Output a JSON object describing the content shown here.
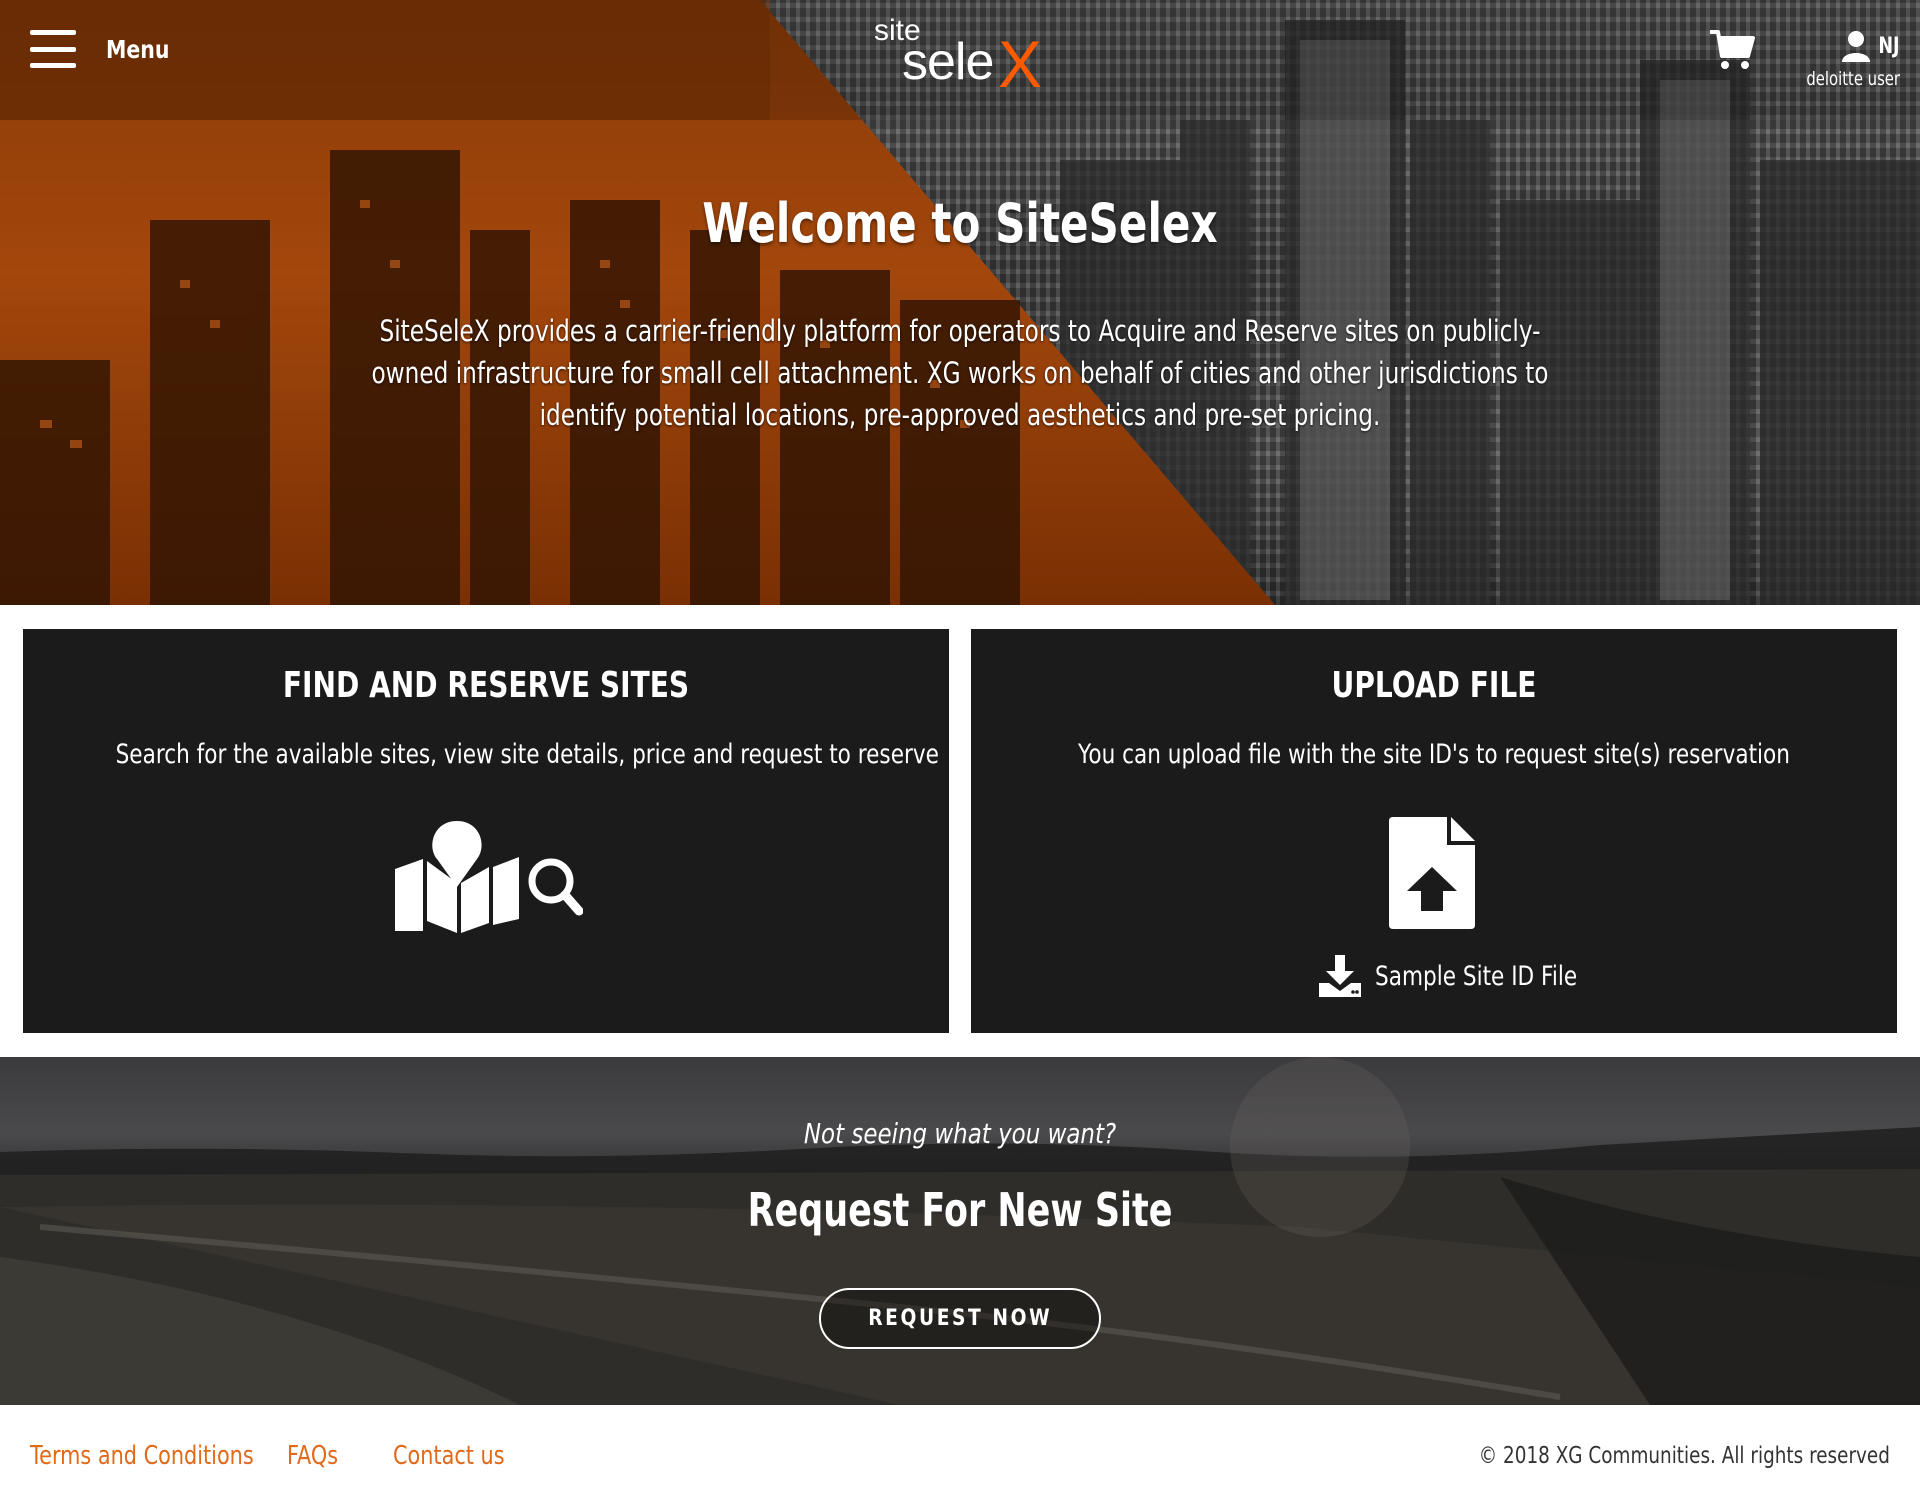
{
  "header": {
    "menu_label": "Menu",
    "logo": {
      "site": "site",
      "sele": "sele",
      "x": "X"
    },
    "user": {
      "initials": "NJ",
      "name": "deloitte user"
    }
  },
  "hero": {
    "title": "Welcome to SiteSelex",
    "description": "SiteSeleX provides a carrier-friendly platform for operators to Acquire and Reserve sites on publicly-owned infrastructure for small cell attachment. XG works on behalf of cities and other jurisdictions to identify potential locations, pre-approved aesthetics and pre-set pricing."
  },
  "cards": {
    "find": {
      "title": "FIND AND RESERVE SITES",
      "description": "Search for the available sites, view site details, price and request to reserve"
    },
    "upload": {
      "title": "UPLOAD FILE",
      "description": "You can upload file with the site ID's to request site(s) reservation",
      "sample_label": "Sample Site ID File"
    }
  },
  "request": {
    "question": "Not seeing what you want?",
    "title": "Request For New Site",
    "button_label": "REQUEST NOW"
  },
  "footer": {
    "links": [
      "Terms and Conditions",
      "FAQs",
      "Contact us"
    ],
    "copyright": "© 2018 XG Communities. All rights reserved"
  },
  "colors": {
    "accent": "#ff5a00",
    "footer_link": "#e06a1a",
    "card_bg": "#1b1b1b"
  }
}
